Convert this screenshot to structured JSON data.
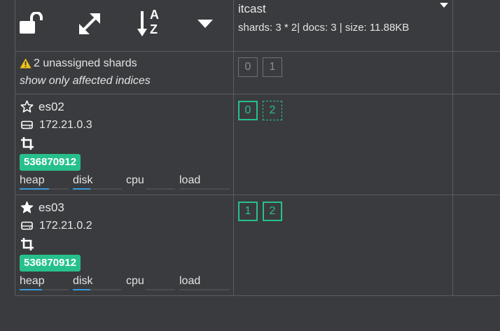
{
  "toolbar": {
    "lock_icon": "unlock-icon",
    "expand_icon": "expand-icon",
    "sort_icon": "sort-alpha-icon",
    "sort_a": "A",
    "sort_z": "Z",
    "dropdown_icon": "caret-down-icon"
  },
  "index": {
    "name": "itcast",
    "stats": "shards: 3 * 2| docs: 3 | size: 11.88KB"
  },
  "unassigned": {
    "warning_text": "2 unassigned shards",
    "filter_link": "show only affected indices",
    "shards": [
      "0",
      "1"
    ]
  },
  "nodes": [
    {
      "name": "es02",
      "ip": "172.21.0.3",
      "heap_max": "536870912",
      "metrics": [
        "heap",
        "disk",
        "cpu",
        "load"
      ],
      "metric_levels": {
        "heap": 0.6,
        "disk": 0.35,
        "cpu": 0,
        "load": 0
      },
      "shards": [
        "0",
        "2"
      ]
    },
    {
      "name": "es03",
      "ip": "172.21.0.2",
      "heap_max": "536870912",
      "metrics": [
        "heap",
        "disk",
        "cpu",
        "load"
      ],
      "metric_levels": {
        "heap": 0.45,
        "disk": 0.35,
        "cpu": 0,
        "load": 0
      },
      "shards": [
        "1",
        "2"
      ]
    }
  ],
  "colors": {
    "background": "#3a3b3e",
    "grid_line": "#5b5c60",
    "shard_green": "#27c08c",
    "warning_yellow": "#f0c419",
    "metric_blue": "#3a9bdc"
  }
}
